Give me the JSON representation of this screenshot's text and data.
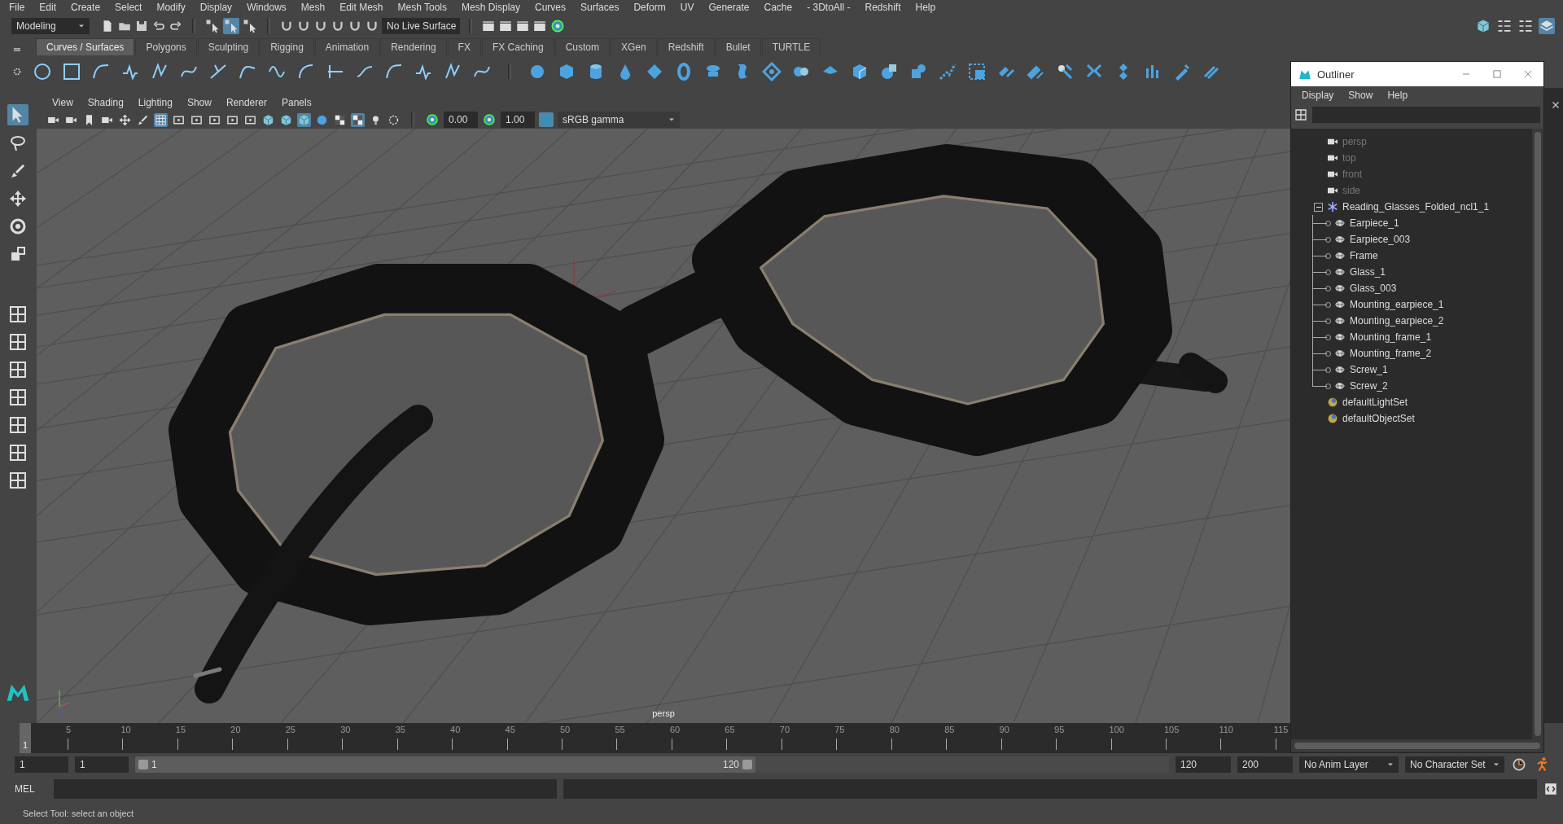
{
  "menu_bar": [
    "File",
    "Edit",
    "Create",
    "Select",
    "Modify",
    "Display",
    "Windows",
    "Mesh",
    "Edit Mesh",
    "Mesh Tools",
    "Mesh Display",
    "Curves",
    "Surfaces",
    "Deform",
    "UV",
    "Generate",
    "Cache",
    "- 3DtoAll -",
    "Redshift",
    "Help"
  ],
  "status_line": {
    "mode": "Modeling",
    "select_tools": [
      {
        "on": false
      },
      {
        "on": true
      },
      {
        "on": false
      }
    ],
    "live_surface": "No Live Surface"
  },
  "shelf": {
    "tabs": [
      {
        "label": "Curves / Surfaces",
        "selected": true
      },
      {
        "label": "Polygons",
        "selected": false
      },
      {
        "label": "Sculpting",
        "selected": false
      },
      {
        "label": "Rigging",
        "selected": false
      },
      {
        "label": "Animation",
        "selected": false
      },
      {
        "label": "Rendering",
        "selected": false
      },
      {
        "label": "FX",
        "selected": false
      },
      {
        "label": "FX Caching",
        "selected": false
      },
      {
        "label": "Custom",
        "selected": false
      },
      {
        "label": "XGen",
        "selected": false
      },
      {
        "label": "Redshift",
        "selected": false
      },
      {
        "label": "Bullet",
        "selected": false
      },
      {
        "label": "TURTLE",
        "selected": false
      }
    ]
  },
  "viewport": {
    "menus": [
      "View",
      "Shading",
      "Lighting",
      "Show",
      "Renderer",
      "Panels"
    ],
    "toolbar": [
      {
        "on": false
      },
      {
        "on": false
      },
      {
        "on": false
      },
      {
        "on": false
      },
      {
        "on": false
      },
      {
        "on": false
      },
      {
        "on": true
      },
      {
        "on": false
      },
      {
        "on": false
      },
      {
        "on": false
      },
      {
        "on": false
      },
      {
        "on": false
      },
      {
        "on": false
      },
      {
        "on": false
      },
      {
        "on": true
      },
      {
        "on": false
      },
      {
        "on": false
      },
      {
        "on": true
      },
      {
        "on": false
      },
      {
        "on": false
      }
    ],
    "exposure": "0.00",
    "gamma": "1.00",
    "color_space": "sRGB gamma",
    "camera_label": "persp"
  },
  "outliner": {
    "title": "Outliner",
    "menus": [
      "Display",
      "Show",
      "Help"
    ],
    "items": [
      {
        "label": "persp",
        "kind": "camera",
        "dimmed": true
      },
      {
        "label": "top",
        "kind": "camera",
        "dimmed": true
      },
      {
        "label": "front",
        "kind": "camera",
        "dimmed": true
      },
      {
        "label": "side",
        "kind": "camera",
        "dimmed": true
      },
      {
        "label": "Reading_Glasses_Folded_ncl1_1",
        "kind": "group",
        "dimmed": false,
        "expanded": true,
        "children": [
          {
            "label": "Earpiece_1",
            "kind": "mesh",
            "dimmed": false
          },
          {
            "label": "Earpiece_003",
            "kind": "mesh",
            "dimmed": false
          },
          {
            "label": "Frame",
            "kind": "mesh",
            "dimmed": false
          },
          {
            "label": "Glass_1",
            "kind": "mesh",
            "dimmed": false
          },
          {
            "label": "Glass_003",
            "kind": "mesh",
            "dimmed": false
          },
          {
            "label": "Mounting_earpiece_1",
            "kind": "mesh",
            "dimmed": false
          },
          {
            "label": "Mounting_earpiece_2",
            "kind": "mesh",
            "dimmed": false
          },
          {
            "label": "Mounting_frame_1",
            "kind": "mesh",
            "dimmed": false
          },
          {
            "label": "Mounting_frame_2",
            "kind": "mesh",
            "dimmed": false
          },
          {
            "label": "Screw_1",
            "kind": "mesh",
            "dimmed": false
          },
          {
            "label": "Screw_2",
            "kind": "mesh",
            "dimmed": false
          }
        ]
      },
      {
        "label": "defaultLightSet",
        "kind": "set",
        "dimmed": false
      },
      {
        "label": "defaultObjectSet",
        "kind": "set",
        "dimmed": false
      }
    ]
  },
  "timeline": {
    "current_frame": "1",
    "ticks": [
      "5",
      "10",
      "15",
      "20",
      "25",
      "30",
      "35",
      "40",
      "45",
      "50",
      "55",
      "60",
      "65",
      "70",
      "75",
      "80",
      "85",
      "90",
      "95",
      "100",
      "105",
      "110",
      "115"
    ]
  },
  "range": {
    "level": 0.6,
    "start": "1",
    "playback_start": "1",
    "slider_start": "1",
    "slider_end": "120",
    "playback_end": "120",
    "end": "200",
    "anim_layer": "No Anim Layer",
    "character_set": "No Character Set"
  },
  "command_line": {
    "language": "MEL"
  },
  "help_line": "Select Tool: select an object"
}
